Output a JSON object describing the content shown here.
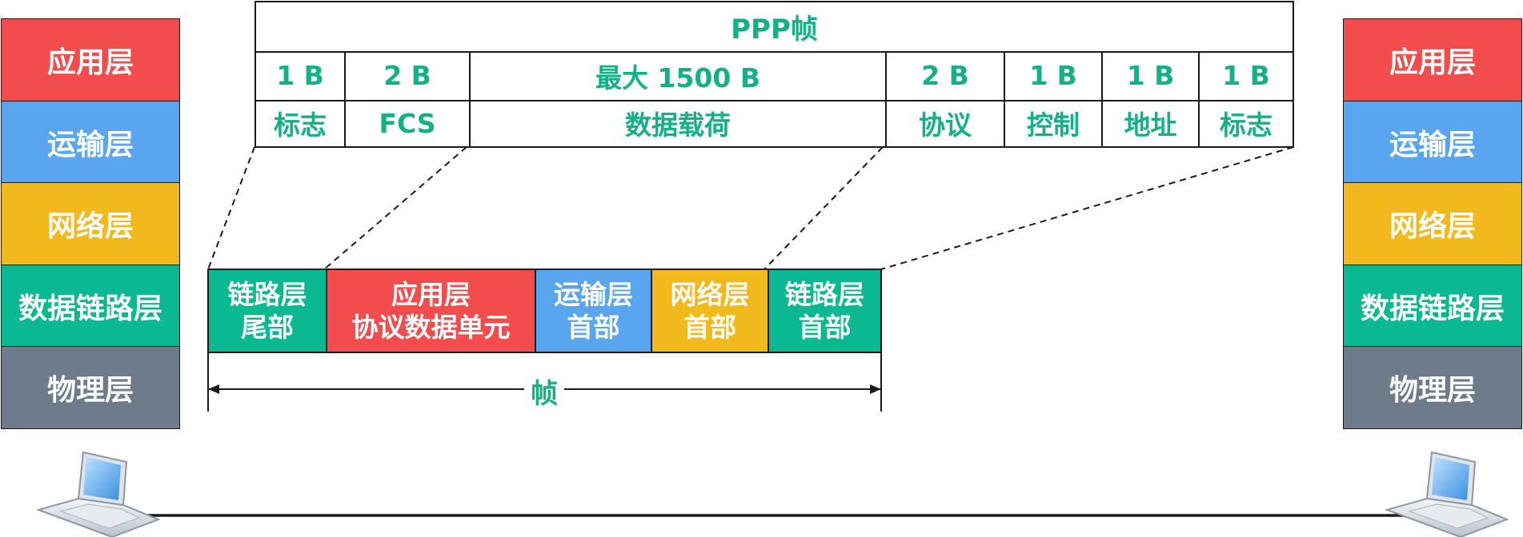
{
  "colors": {
    "application": "#f24c4c",
    "transport": "#5aa6ee",
    "network": "#f2b91c",
    "datalink": "#0ab891",
    "physical": "#6e7b8b",
    "accent_text": "#14b088"
  },
  "left_stack": {
    "layers": [
      "应用层",
      "运输层",
      "网络层",
      "数据链路层",
      "物理层"
    ]
  },
  "right_stack": {
    "layers": [
      "应用层",
      "运输层",
      "网络层",
      "数据链路层",
      "物理层"
    ]
  },
  "ppp_frame": {
    "title": "PPP帧",
    "fields": [
      {
        "size": "1 B",
        "name": "标志"
      },
      {
        "size": "2 B",
        "name": "FCS"
      },
      {
        "size": "最大 1500 B",
        "name": "数据载荷"
      },
      {
        "size": "2 B",
        "name": "协议"
      },
      {
        "size": "1 B",
        "name": "控制"
      },
      {
        "size": "1 B",
        "name": "地址"
      },
      {
        "size": "1 B",
        "name": "标志"
      }
    ]
  },
  "encapsulated_frame": {
    "segments": [
      {
        "line1": "链路层",
        "line2": "尾部"
      },
      {
        "line1": "应用层",
        "line2": "协议数据单元"
      },
      {
        "line1": "运输层",
        "line2": "首部"
      },
      {
        "line1": "网络层",
        "line2": "首部"
      },
      {
        "line1": "链路层",
        "line2": "首部"
      }
    ],
    "span_label": "帧"
  },
  "icons": {
    "left_host": "laptop-icon",
    "right_host": "laptop-icon"
  }
}
